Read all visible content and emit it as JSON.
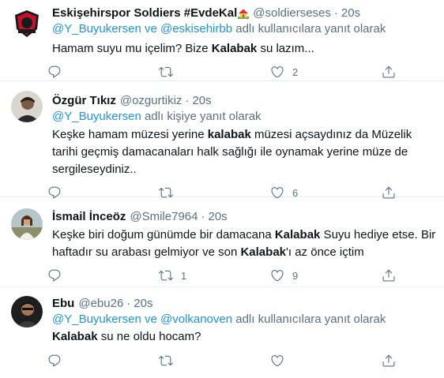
{
  "tweets": [
    {
      "name": "Eskişehirspor Soldiers #EvdeKal",
      "handle": "@soldierseses",
      "time": "20s",
      "reply_mentions": "@Y_Buyukersen ve @eskisehirbb",
      "reply_suffix": "adlı kullanıcılara yanıt olarak",
      "text_parts": [
        "Hamam suyu mu içelim? Bize ",
        "Kalabak",
        " su lazım..."
      ],
      "replies": "",
      "retweets": "",
      "likes": "2"
    },
    {
      "name": "Özgür Tıkız",
      "handle": "@ozgurtikiz",
      "time": "20s",
      "reply_mentions": "@Y_Buyukersen",
      "reply_suffix": "adlı kişiye yanıt olarak",
      "text_parts": [
        "Keşke hamam müzesi yerine ",
        "kalabak",
        " müzesi açsaydınız da Müzelik tarihi geçmiş damacanaları halk sağlığı ile oynamak yerine müze de sergileseydiniz.."
      ],
      "replies": "",
      "retweets": "",
      "likes": "6"
    },
    {
      "name": "İsmail İnceöz",
      "handle": "@Smile7964",
      "time": "20s",
      "text_parts": [
        "Keşke biri doğum günümde bir damacana ",
        "Kalabak",
        " Suyu hediye etse. Bir haftadır su arabası gelmiyor ve son ",
        "Kalabak",
        "'ı az önce içtim"
      ],
      "replies": "",
      "retweets": "1",
      "likes": "9"
    },
    {
      "name": "Ebu",
      "handle": "@ebu26",
      "time": "20s",
      "reply_mentions": "@Y_Buyukersen ve @volkanoven",
      "reply_suffix": "adlı kullanıcılara yanıt olarak",
      "text_parts": [
        "Kalabak",
        " su ne oldu hocam?"
      ],
      "replies": "",
      "retweets": "",
      "likes": ""
    }
  ],
  "separator": "·",
  "icons": {
    "reply": "reply-icon",
    "retweet": "retweet-icon",
    "like": "heart-icon",
    "share": "share-icon",
    "house": "house-with-garden-emoji"
  },
  "colors": {
    "mention": "#1b95e0",
    "secondary": "#5b7083",
    "divider": "#e6ecf0"
  }
}
